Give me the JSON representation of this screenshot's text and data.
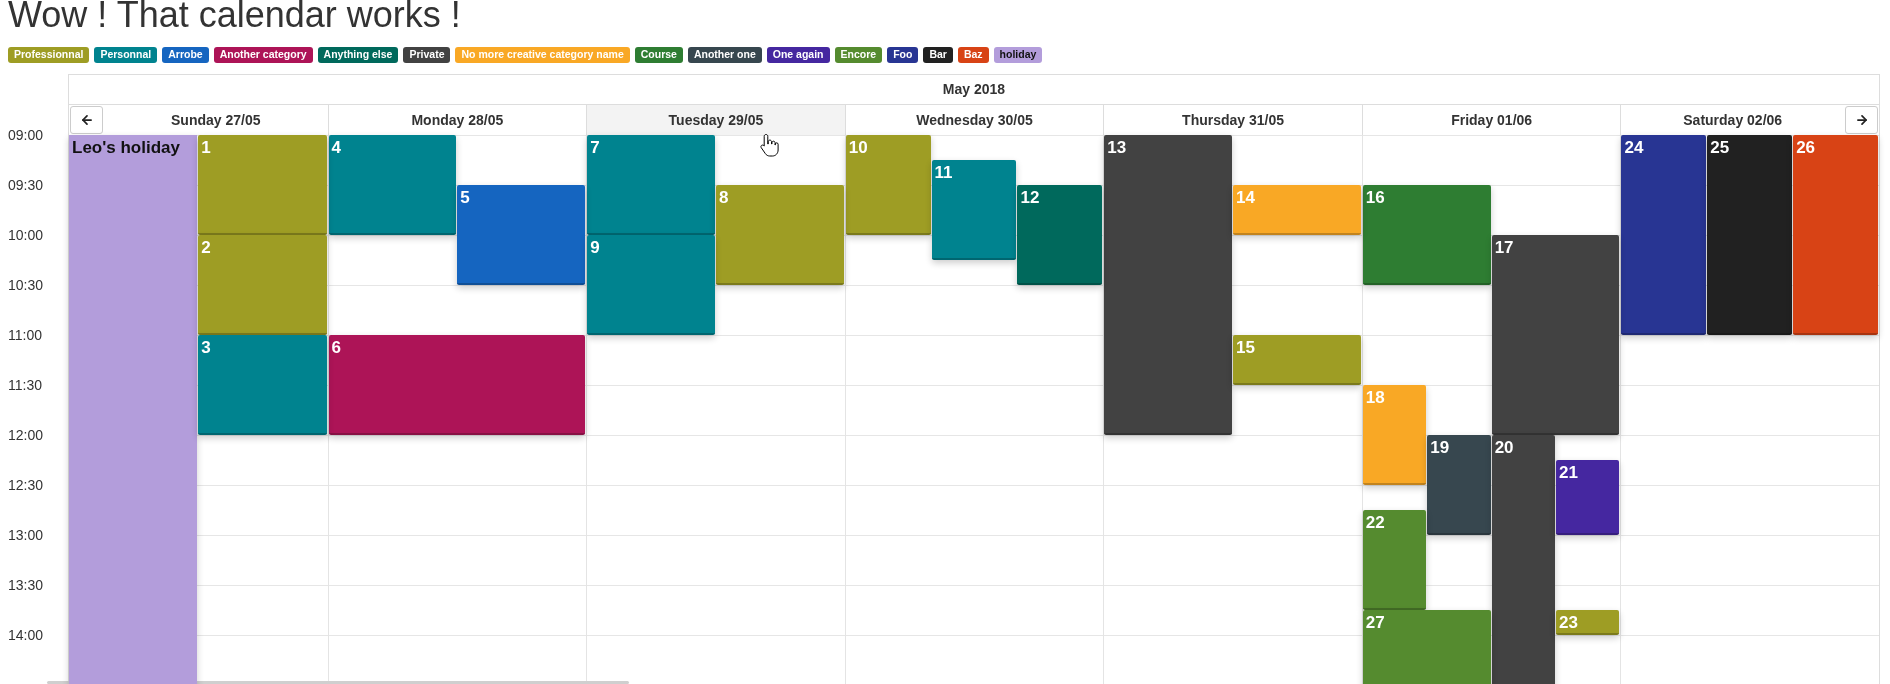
{
  "title": "Wow ! That calendar works !",
  "categories": [
    {
      "label": "Professionnal",
      "color": "#9e9d24",
      "kind": "category"
    },
    {
      "label": "Personnal",
      "color": "#00838f",
      "kind": "category"
    },
    {
      "label": "Arrobe",
      "color": "#1565c0",
      "kind": "category"
    },
    {
      "label": "Another category",
      "color": "#ad1457",
      "kind": "category"
    },
    {
      "label": "Anything else",
      "color": "#00695c",
      "kind": "category"
    },
    {
      "label": "Private",
      "color": "#424242",
      "kind": "category"
    },
    {
      "label": "No more creative category name",
      "color": "#f9a825",
      "kind": "category"
    },
    {
      "label": "Course",
      "color": "#2e7d32",
      "kind": "category"
    },
    {
      "label": "Another one",
      "color": "#37474f",
      "kind": "category"
    },
    {
      "label": "One again",
      "color": "#4527a0",
      "kind": "category"
    },
    {
      "label": "Encore",
      "color": "#558b2f",
      "kind": "category"
    },
    {
      "label": "Foo",
      "color": "#283593",
      "kind": "category"
    },
    {
      "label": "Bar",
      "color": "#212121",
      "kind": "category"
    },
    {
      "label": "Baz",
      "color": "#d84315",
      "kind": "category"
    },
    {
      "label": "holiday",
      "color": "#b39ddb",
      "kind": "holiday"
    }
  ],
  "calendar": {
    "month": "May 2018",
    "times": [
      "09:00",
      "09:30",
      "10:00",
      "10:30",
      "11:00",
      "11:30",
      "12:00",
      "12:30",
      "13:00",
      "13:30",
      "14:00"
    ],
    "days": [
      {
        "label": "Sunday 27/05",
        "hovered": false,
        "events": [
          {
            "label": "Leo's holiday",
            "color": "#b39ddb",
            "kind": "holiday"
          },
          {
            "label": "1",
            "color": "#9e9d24",
            "kind": "event"
          },
          {
            "label": "2",
            "color": "#9e9d24",
            "kind": "event"
          },
          {
            "label": "3",
            "color": "#00838f",
            "kind": "event"
          }
        ]
      },
      {
        "label": "Monday 28/05",
        "hovered": false,
        "events": [
          {
            "label": "4",
            "color": "#00838f",
            "kind": "event"
          },
          {
            "label": "5",
            "color": "#1565c0",
            "kind": "event"
          },
          {
            "label": "6",
            "color": "#ad1457",
            "kind": "event"
          }
        ]
      },
      {
        "label": "Tuesday 29/05",
        "hovered": true,
        "events": [
          {
            "label": "7",
            "color": "#00838f",
            "kind": "event"
          },
          {
            "label": "8",
            "color": "#9e9d24",
            "kind": "event"
          },
          {
            "label": "9",
            "color": "#00838f",
            "kind": "event"
          }
        ]
      },
      {
        "label": "Wednesday 30/05",
        "hovered": false,
        "events": [
          {
            "label": "10",
            "color": "#9e9d24",
            "kind": "event"
          },
          {
            "label": "11",
            "color": "#00838f",
            "kind": "event"
          },
          {
            "label": "12",
            "color": "#00695c",
            "kind": "event"
          }
        ]
      },
      {
        "label": "Thursday 31/05",
        "hovered": false,
        "events": [
          {
            "label": "13",
            "color": "#424242",
            "kind": "event"
          },
          {
            "label": "14",
            "color": "#f9a825",
            "kind": "event"
          },
          {
            "label": "15",
            "color": "#9e9d24",
            "kind": "event"
          }
        ]
      },
      {
        "label": "Friday 01/06",
        "hovered": false,
        "events": [
          {
            "label": "16",
            "color": "#2e7d32",
            "kind": "event"
          },
          {
            "label": "17",
            "color": "#424242",
            "kind": "event"
          },
          {
            "label": "18",
            "color": "#f9a825",
            "kind": "event"
          },
          {
            "label": "19",
            "color": "#37474f",
            "kind": "event"
          },
          {
            "label": "20",
            "color": "#424242",
            "kind": "event"
          },
          {
            "label": "21",
            "color": "#4527a0",
            "kind": "event"
          },
          {
            "label": "22",
            "color": "#558b2f",
            "kind": "event"
          },
          {
            "label": "23",
            "color": "#9e9d24",
            "kind": "event"
          },
          {
            "label": "27",
            "color": "#558b2f",
            "kind": "event"
          }
        ]
      },
      {
        "label": "Saturday 02/06",
        "hovered": false,
        "events": [
          {
            "label": "24",
            "color": "#283593",
            "kind": "event"
          },
          {
            "label": "25",
            "color": "#212121",
            "kind": "event"
          },
          {
            "label": "26",
            "color": "#d84315",
            "kind": "event"
          }
        ]
      }
    ]
  }
}
